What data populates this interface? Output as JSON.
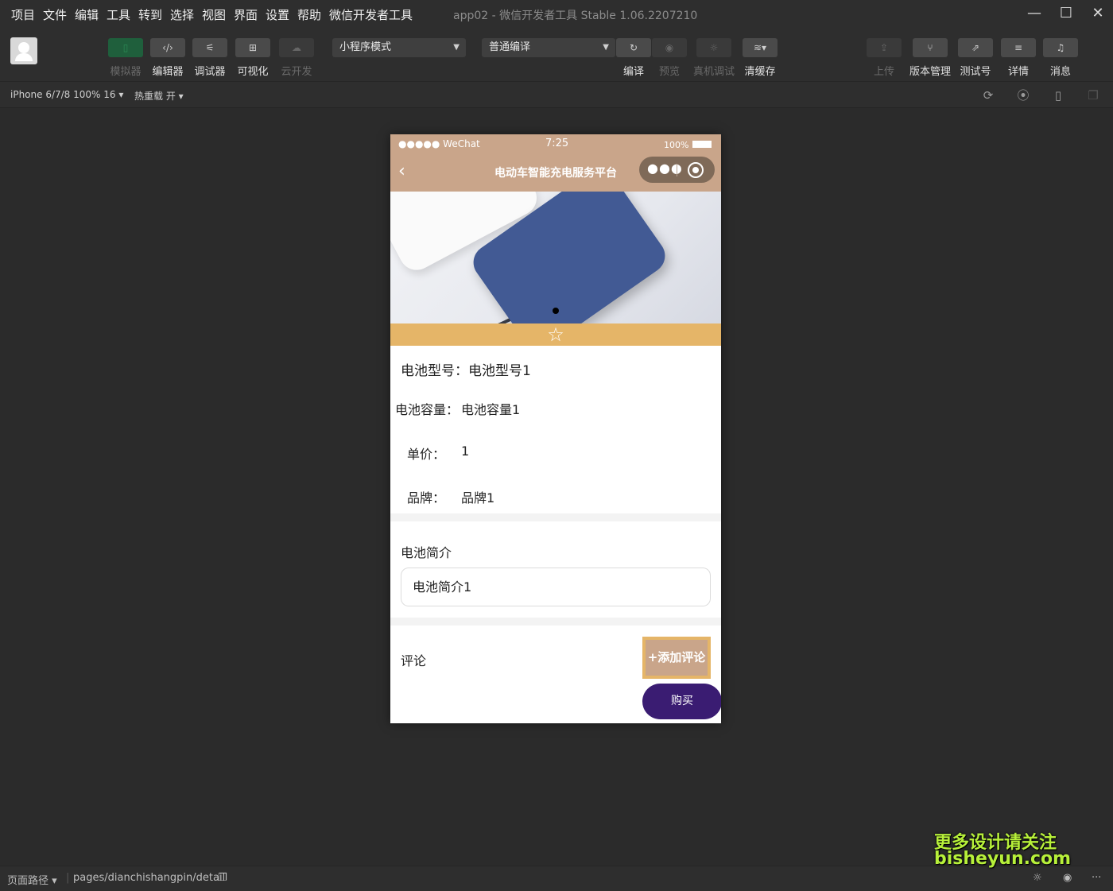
{
  "menubar": {
    "items": [
      "项目",
      "文件",
      "编辑",
      "工具",
      "转到",
      "选择",
      "视图",
      "界面",
      "设置",
      "帮助",
      "微信开发者工具"
    ],
    "title": "app02 - 微信开发者工具 Stable 1.06.2207210",
    "minimize": "—",
    "maximize": "☐",
    "close": "✕"
  },
  "toolbar": {
    "simulator": "模拟器",
    "editor": "编辑器",
    "debugger": "调试器",
    "visual": "可视化",
    "cloud": "云开发",
    "mode_select": "小程序模式",
    "compile_select": "普通编译",
    "compile": "编译",
    "preview": "预览",
    "remote_debug": "真机调试",
    "clear_cache": "清缓存",
    "upload": "上传",
    "version": "版本管理",
    "test_account": "测试号",
    "details": "详情",
    "messages": "消息"
  },
  "subbar": {
    "device": "iPhone 6/7/8 100% 16 ▾",
    "hot_reload": "热重载 开 ▾"
  },
  "phone": {
    "status": {
      "carrier": "●●●●● WeChat",
      "time": "7:25",
      "battery": "100%"
    },
    "nav_title": "电动车智能充电服务平台",
    "fields": {
      "model_label": "电池型号：",
      "model_value": "电池型号1",
      "capacity_label": "电池容量：",
      "capacity_value": "电池容量1",
      "price_label": "单价：",
      "price_value": "1",
      "brand_label": "品牌：",
      "brand_value": "品牌1"
    },
    "intro_title": "电池简介",
    "intro_text": "电池简介1",
    "comment_title": "评论",
    "add_comment": "+添加评论",
    "buy": "购买"
  },
  "bottombar": {
    "path_label": "页面路径 ▾",
    "path": "pages/dianchishangpin/detail"
  },
  "watermark": {
    "line1": "更多设计请关注",
    "line2": "bisheyun.com"
  },
  "icons": [
    "phone-icon",
    "code-icon",
    "debug-icon",
    "layout-icon",
    "cloud-icon",
    "refresh-icon",
    "eye-icon",
    "bug-icon",
    "layers-icon",
    "upload-icon",
    "branch-icon",
    "external-link-icon",
    "menu-icon",
    "bell-icon",
    "rotate-icon",
    "stop-icon",
    "device-icon",
    "copy-icon",
    "star-icon",
    "back-icon"
  ]
}
